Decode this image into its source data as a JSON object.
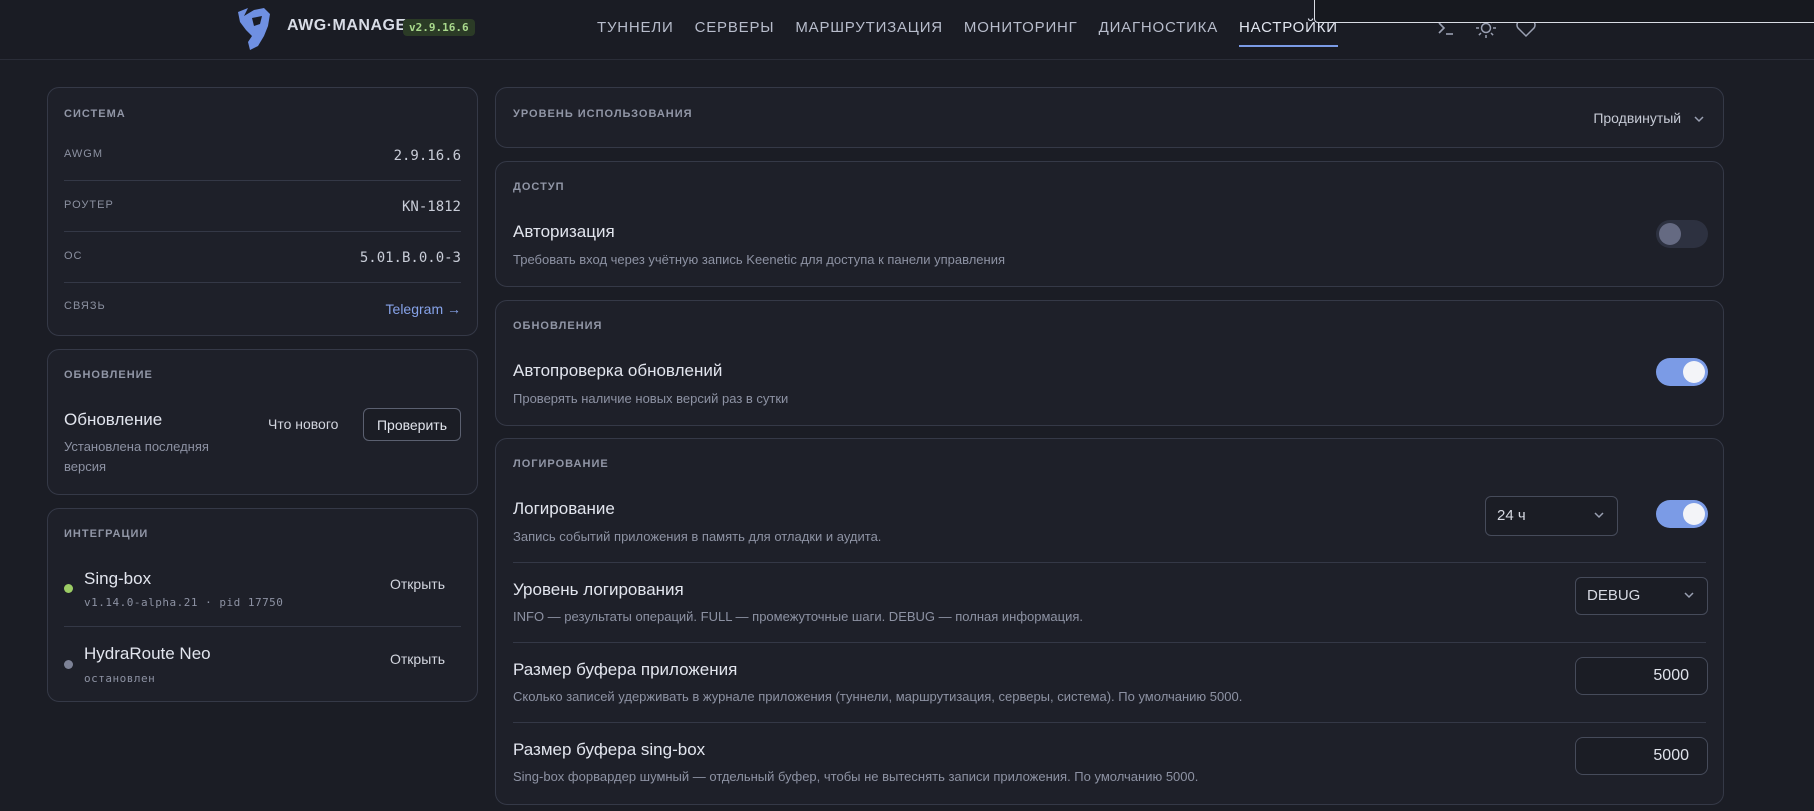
{
  "header": {
    "brand": "AWG·MANAGER",
    "version": "v2.9.16.6",
    "nav": [
      "ТУННЕЛИ",
      "СЕРВЕРЫ",
      "МАРШРУТИЗАЦИЯ",
      "МОНИТОРИНГ",
      "ДИАГНОСТИКА",
      "НАСТРОЙКИ"
    ],
    "active_nav": "НАСТРОЙКИ",
    "icons": [
      "terminal-icon",
      "sun-icon",
      "heart-icon"
    ]
  },
  "system": {
    "title": "СИСТЕМА",
    "rows": [
      {
        "label": "AWGM",
        "value": "2.9.16.6"
      },
      {
        "label": "РОУТЕР",
        "value": "KN-1812"
      },
      {
        "label": "ОС",
        "value": "5.01.B.0.0-3"
      },
      {
        "label": "СВЯЗЬ",
        "value": "Telegram →"
      }
    ]
  },
  "update": {
    "section": "ОБНОВЛЕНИЕ",
    "title": "Обновление",
    "desc_line1": "Установлена последняя",
    "desc_line2": "версия",
    "whats_new": "Что нового",
    "check": "Проверить"
  },
  "integrations": {
    "section": "ИНТЕГРАЦИИ",
    "items": [
      {
        "name": "Sing-box",
        "detail": "v1.14.0-alpha.21 · pid 17750",
        "status_color": "#9ccc65",
        "action": "Открыть"
      },
      {
        "name": "HydraRoute Neo",
        "detail": "остановлен",
        "status_color": "#7d8296",
        "action": "Открыть"
      }
    ]
  },
  "usage": {
    "section": "УРОВЕНЬ ИСПОЛЬЗОВАНИЯ",
    "value": "Продвинутый"
  },
  "access": {
    "section": "ДОСТУП",
    "title": "Авторизация",
    "desc": "Требовать вход через учётную запись Keenetic для доступа к панели управления",
    "enabled": false
  },
  "updates": {
    "section": "ОБНОВЛЕНИЯ",
    "title": "Автопроверка обновлений",
    "desc": "Проверять наличие новых версий раз в сутки",
    "enabled": true
  },
  "logging": {
    "section": "ЛОГИРОВАНИЕ",
    "log": {
      "title": "Логирование",
      "desc": "Запись событий приложения в память для отладки и аудита.",
      "retention": "24 ч",
      "enabled": true
    },
    "level": {
      "title": "Уровень логирования",
      "desc": "INFO — результаты операций. FULL — промежуточные шаги. DEBUG — полная информация.",
      "value": "DEBUG"
    },
    "app_buffer": {
      "title": "Размер буфера приложения",
      "desc": "Сколько записей удерживать в журнале приложения (туннели, маршрутизация, серверы, система). По умолчанию 5000.",
      "value": "5000"
    },
    "singbox_buffer": {
      "title": "Размер буфера sing-box",
      "desc": "Sing-box форвардер шумный — отдельный буфер, чтобы не вытеснять записи приложения. По умолчанию 5000.",
      "value": "5000"
    }
  }
}
